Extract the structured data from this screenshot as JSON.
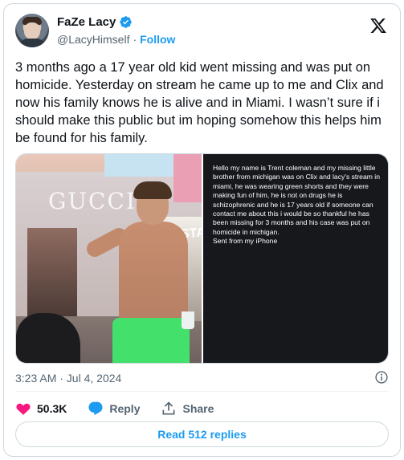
{
  "author": {
    "display_name": "FaZe Lacy",
    "handle": "@LacyHimself",
    "separator": "·",
    "follow_label": "Follow",
    "verified_color": "#1d9bf0"
  },
  "tweet": {
    "text": "3 months ago a 17 year old kid went missing and was put on homicide. Yesterday on stream he came up to me and Clix and now his family knows he is alive and in Miami. I wasn’t sure if i should make this public but im hoping somehow this helps him be found for his family.",
    "timestamp": "3:23 AM · Jul 4, 2024"
  },
  "media": {
    "photo_store_sign": "GUCCI",
    "photo_sign_right": "STAR",
    "dm_message": "Hello my name is Trent coleman and my missing little brother from michigan was on Clix and lacy's stream in miami, he was wearing green shorts and they were making fun of him, he is not on drugs he is schizophrenic and he is 17 years old if someone can contact me about this i would be so thankful he has been missing for 3 months and his case was put on homicide in michigan.",
    "dm_signature": "Sent from my iPhone"
  },
  "actions": {
    "like_count": "50.3K",
    "reply_label": "Reply",
    "share_label": "Share",
    "read_replies_label": "Read 512 replies"
  },
  "colors": {
    "like_heart": "#f91880",
    "link_blue": "#1d9bf0",
    "muted_text": "#536471"
  },
  "icons": {
    "verified": "verified-badge-icon",
    "x_logo": "x-logo-icon",
    "info": "info-icon",
    "heart": "heart-icon",
    "reply": "reply-icon",
    "share": "share-icon"
  }
}
